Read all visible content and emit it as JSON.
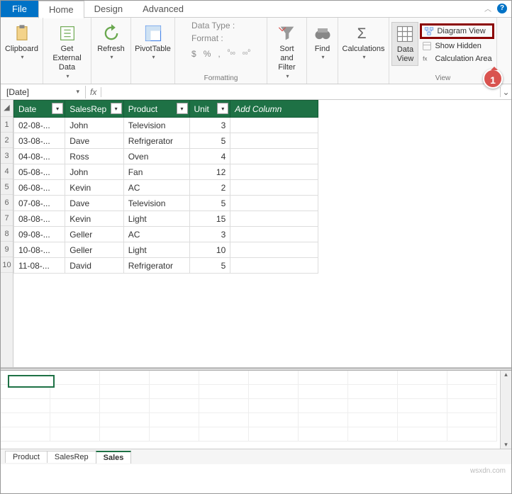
{
  "tabs": {
    "file": "File",
    "home": "Home",
    "design": "Design",
    "advanced": "Advanced"
  },
  "ribbon": {
    "clipboard": {
      "label": "Clipboard"
    },
    "get_data": {
      "label": "Get External\nData"
    },
    "refresh": {
      "label": "Refresh"
    },
    "pivot": {
      "label": "PivotTable"
    },
    "datatype_lbl": "Data Type :",
    "format_lbl": "Format :",
    "fmt_dollar": "$",
    "fmt_percent": "%",
    "fmt_comma": ",",
    "fmt_inc": ".0\n.00",
    "fmt_dec": ".00\n.0",
    "formatting_group": "Formatting",
    "sortfilter": "Sort and\nFilter",
    "find": "Find",
    "calculations": "Calculations",
    "dataview": "Data\nView",
    "diagramview": "Diagram View",
    "showhidden": "Show Hidden",
    "calcarea": "Calculation Area",
    "view_group": "View"
  },
  "namebox": "[Date]",
  "fx": "fx",
  "headers": {
    "date": "Date",
    "salesrep": "SalesRep",
    "product": "Product",
    "unit": "Unit",
    "addcol": "Add Column"
  },
  "rows": [
    {
      "n": "1",
      "date": "02-08-...",
      "rep": "John",
      "product": "Television",
      "unit": "3"
    },
    {
      "n": "2",
      "date": "03-08-...",
      "rep": "Dave",
      "product": "Refrigerator",
      "unit": "5"
    },
    {
      "n": "3",
      "date": "04-08-...",
      "rep": "Ross",
      "product": "Oven",
      "unit": "4"
    },
    {
      "n": "4",
      "date": "05-08-...",
      "rep": "John",
      "product": "Fan",
      "unit": "12"
    },
    {
      "n": "5",
      "date": "06-08-...",
      "rep": "Kevin",
      "product": "AC",
      "unit": "2"
    },
    {
      "n": "6",
      "date": "07-08-...",
      "rep": "Dave",
      "product": "Television",
      "unit": "5"
    },
    {
      "n": "7",
      "date": "08-08-...",
      "rep": "Kevin",
      "product": "Light",
      "unit": "15"
    },
    {
      "n": "8",
      "date": "09-08-...",
      "rep": "Geller",
      "product": "AC",
      "unit": "3"
    },
    {
      "n": "9",
      "date": "10-08-...",
      "rep": "Geller",
      "product": "Light",
      "unit": "10"
    },
    {
      "n": "10",
      "date": "11-08-...",
      "rep": "David",
      "product": "Refrigerator",
      "unit": "5"
    }
  ],
  "sheets": {
    "product": "Product",
    "salesrep": "SalesRep",
    "sales": "Sales"
  },
  "callout": "1",
  "watermark": "wsxdn.com"
}
